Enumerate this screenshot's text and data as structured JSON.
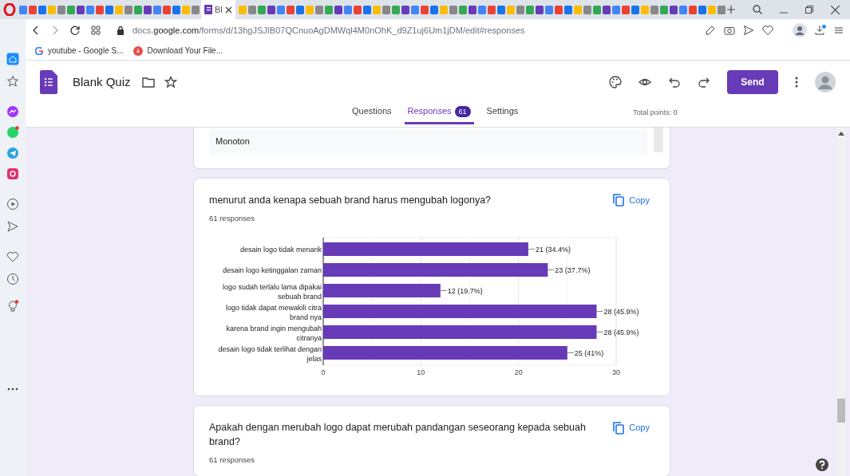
{
  "browser": {
    "active_tab": {
      "title": "Bl"
    },
    "url": {
      "prefix": "docs.",
      "domain": "google.com",
      "path": "/forms/d/13hgJSJIB07QCnuoAgDMWql4M0nOhK_d9Z1uj6Um1jDM/edit#responses"
    },
    "bookmarks": [
      {
        "label": "youtube - Google S..."
      },
      {
        "label": "Download Your File..."
      }
    ]
  },
  "form_header": {
    "title": "Blank Quiz",
    "send_label": "Send",
    "tabs": [
      {
        "label": "Questions",
        "selected": false
      },
      {
        "label": "Responses",
        "selected": true,
        "badge": "61"
      },
      {
        "label": "Settings",
        "selected": false
      }
    ],
    "total_points": "Total points: 0"
  },
  "cards": [
    {
      "kind": "answer_list",
      "answers": [
        "Monoton"
      ]
    },
    {
      "kind": "chart",
      "question": "menurut anda kenapa sebuah brand harus mengubah logonya?",
      "responses": "61 responses",
      "copy_label": "Copy",
      "chart_data": {
        "type": "bar",
        "orientation": "horizontal",
        "categories": [
          "desain logo tidak menarik",
          "desain logo ketinggalan zaman",
          "logo sudah terlalu lama dipakai sebuah brand",
          "logo tidak dapat mewakili citra brand nya",
          "karena brand ingin mengubah citranya",
          "desain logo tidak terlihat dengan jelas"
        ],
        "values": [
          21,
          23,
          12,
          28,
          28,
          25
        ],
        "value_labels": [
          "21 (34.4%)",
          "23 (37.7%)",
          "12 (19.7%)",
          "28 (45.9%)",
          "28 (45.9%)",
          "25 (41%)"
        ],
        "xlim": [
          0,
          30
        ],
        "xticks": [
          0,
          10,
          20,
          30
        ]
      }
    },
    {
      "kind": "question",
      "question": "Apakah dengan merubah logo dapat merubah pandangan seseorang kepada sebuah brand?",
      "responses": "61 responses",
      "copy_label": "Copy"
    }
  ]
}
